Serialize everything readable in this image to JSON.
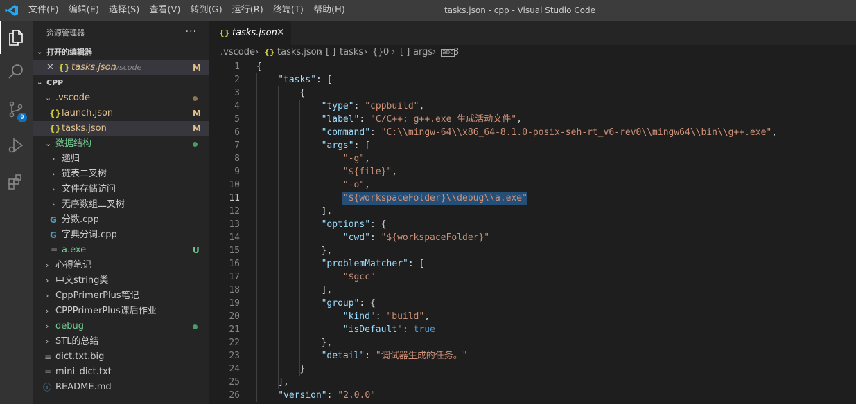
{
  "window": {
    "title": "tasks.json - cpp - Visual Studio Code",
    "menu": [
      "文件(F)",
      "编辑(E)",
      "选择(S)",
      "查看(V)",
      "转到(G)",
      "运行(R)",
      "终端(T)",
      "帮助(H)"
    ]
  },
  "activity": {
    "scm_badge": "9"
  },
  "sidebar": {
    "title": "资源管理器",
    "more": "···",
    "open_editors": {
      "title": "打开的编辑器",
      "item": {
        "name": "tasks.json",
        "path": ".vscode",
        "status": "M"
      }
    },
    "project": {
      "title": "CPP",
      "items": [
        {
          "label": ".vscode"
        },
        {
          "label": "launch.json",
          "status": "M"
        },
        {
          "label": "tasks.json",
          "status": "M"
        },
        {
          "label": "数据结构"
        },
        {
          "label": "递归"
        },
        {
          "label": "链表二叉树"
        },
        {
          "label": "文件存储访问"
        },
        {
          "label": "无序数组二叉树"
        },
        {
          "label": "分数.cpp"
        },
        {
          "label": "字典分词.cpp"
        },
        {
          "label": "a.exe",
          "status": "U"
        },
        {
          "label": "心得笔记"
        },
        {
          "label": "中文string类"
        },
        {
          "label": "CppPrimerPlus笔记"
        },
        {
          "label": "CPPPrimerPlus课后作业"
        },
        {
          "label": "debug"
        },
        {
          "label": "STL的总结"
        },
        {
          "label": "dict.txt.big"
        },
        {
          "label": "mini_dict.txt"
        },
        {
          "label": "README.md"
        }
      ]
    }
  },
  "editor": {
    "tab": {
      "label": "tasks.json"
    },
    "breadcrumb": [
      ".vscode",
      "tasks.json",
      "tasks",
      "0",
      "args",
      "3"
    ],
    "current_line": 11,
    "lines": [
      [
        [
          "p",
          "{"
        ]
      ],
      [
        [
          "k",
          "\"tasks\""
        ],
        [
          "p",
          ": ["
        ]
      ],
      [
        [
          "p",
          "{"
        ]
      ],
      [
        [
          "k",
          "\"type\""
        ],
        [
          "p",
          ": "
        ],
        [
          "s",
          "\"cppbuild\""
        ],
        [
          "p",
          ","
        ]
      ],
      [
        [
          "k",
          "\"label\""
        ],
        [
          "p",
          ": "
        ],
        [
          "s",
          "\"C/C++: g++.exe 生成活动文件\""
        ],
        [
          "p",
          ","
        ]
      ],
      [
        [
          "k",
          "\"command\""
        ],
        [
          "p",
          ": "
        ],
        [
          "s",
          "\"C:\\\\mingw-64\\\\x86_64-8.1.0-posix-seh-rt_v6-rev0\\\\mingw64\\\\bin\\\\g++.exe\""
        ],
        [
          "p",
          ","
        ]
      ],
      [
        [
          "k",
          "\"args\""
        ],
        [
          "p",
          ": ["
        ]
      ],
      [
        [
          "s",
          "\"-g\""
        ],
        [
          "p",
          ","
        ]
      ],
      [
        [
          "s",
          "\"${file}\""
        ],
        [
          "p",
          ","
        ]
      ],
      [
        [
          "s",
          "\"-o\""
        ],
        [
          "p",
          ","
        ]
      ],
      [
        [
          "s",
          "\"${workspaceFolder}\\\\debug\\\\a.exe\""
        ]
      ],
      [
        [
          "p",
          "],"
        ]
      ],
      [
        [
          "k",
          "\"options\""
        ],
        [
          "p",
          ": {"
        ]
      ],
      [
        [
          "k",
          "\"cwd\""
        ],
        [
          "p",
          ": "
        ],
        [
          "s",
          "\"${workspaceFolder}\""
        ]
      ],
      [
        [
          "p",
          "},"
        ]
      ],
      [
        [
          "k",
          "\"problemMatcher\""
        ],
        [
          "p",
          ": ["
        ]
      ],
      [
        [
          "s",
          "\"$gcc\""
        ]
      ],
      [
        [
          "p",
          "],"
        ]
      ],
      [
        [
          "k",
          "\"group\""
        ],
        [
          "p",
          ": {"
        ]
      ],
      [
        [
          "k",
          "\"kind\""
        ],
        [
          "p",
          ": "
        ],
        [
          "s",
          "\"build\""
        ],
        [
          "p",
          ","
        ]
      ],
      [
        [
          "k",
          "\"isDefault\""
        ],
        [
          "p",
          ": "
        ],
        [
          "b",
          "true"
        ]
      ],
      [
        [
          "p",
          "},"
        ]
      ],
      [
        [
          "k",
          "\"detail\""
        ],
        [
          "p",
          ": "
        ],
        [
          "s",
          "\"调试器生成的任务。\""
        ]
      ],
      [
        [
          "p",
          "}"
        ]
      ],
      [
        [
          "p",
          "],"
        ]
      ],
      [
        [
          "k",
          "\"version\""
        ],
        [
          "p",
          ": "
        ],
        [
          "s",
          "\"2.0.0\""
        ]
      ]
    ]
  },
  "colors": {
    "accent": "#0e70c0",
    "modified": "#e2c08d",
    "untracked": "#73c991",
    "selection": "#264f78",
    "json_key": "#9cdcfe",
    "json_string": "#ce9178",
    "json_bool": "#569cd6"
  }
}
